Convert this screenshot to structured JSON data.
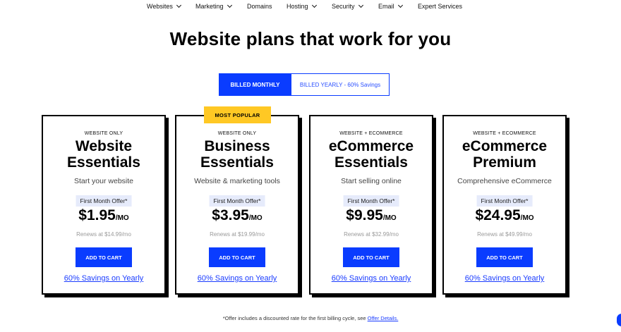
{
  "nav": {
    "items": [
      {
        "label": "Websites",
        "dropdown": true
      },
      {
        "label": "Marketing",
        "dropdown": true
      },
      {
        "label": "Domains",
        "dropdown": false
      },
      {
        "label": "Hosting",
        "dropdown": true
      },
      {
        "label": "Security",
        "dropdown": true
      },
      {
        "label": "Email",
        "dropdown": true
      },
      {
        "label": "Expert Services",
        "dropdown": false
      }
    ]
  },
  "headline": "Website plans that work for you",
  "billing": {
    "monthly_label": "BILLED MONTHLY",
    "yearly_label": "BILLED YEARLY - 60% Savings",
    "selected": "monthly"
  },
  "badge": "MOST POPULAR",
  "plans": [
    {
      "category": "WEBSITE ONLY",
      "name_line1": "Website",
      "name_line2": "Essentials",
      "tagline": "Start your website",
      "offer": "First Month Offer*",
      "price": "$1.95",
      "per": "/MO",
      "renews": "Renews at $14.99/mo",
      "cta": "ADD TO CART",
      "yearly_link": "60% Savings on Yearly"
    },
    {
      "category": "WEBSITE ONLY",
      "name_line1": "Business",
      "name_line2": "Essentials",
      "tagline": "Website & marketing tools",
      "offer": "First Month Offer*",
      "price": "$3.95",
      "per": "/MO",
      "renews": "Renews at $19.99/mo",
      "cta": "ADD TO CART",
      "yearly_link": "60% Savings on Yearly"
    },
    {
      "category": "WEBSITE + ECOMMERCE",
      "name_line1": "eCommerce",
      "name_line2": "Essentials",
      "tagline": "Start selling online",
      "offer": "First Month Offer*",
      "price": "$9.95",
      "per": "/MO",
      "renews": "Renews at $32.99/mo",
      "cta": "ADD TO CART",
      "yearly_link": "60% Savings on Yearly"
    },
    {
      "category": "WEBSITE + ECOMMERCE",
      "name_line1": "eCommerce",
      "name_line2": "Premium",
      "tagline": "Comprehensive eCommerce",
      "offer": "First Month Offer*",
      "price": "$24.95",
      "per": "/MO",
      "renews": "Renews at $49.99/mo",
      "cta": "ADD TO CART",
      "yearly_link": "60% Savings on Yearly"
    }
  ],
  "footnote": {
    "text": "*Offer includes a discounted rate for the first billing cycle, see ",
    "link": "Offer Details."
  },
  "colors": {
    "accent": "#0a3cff",
    "badge": "#ffc824",
    "offer_bg": "#e6ebfb"
  }
}
